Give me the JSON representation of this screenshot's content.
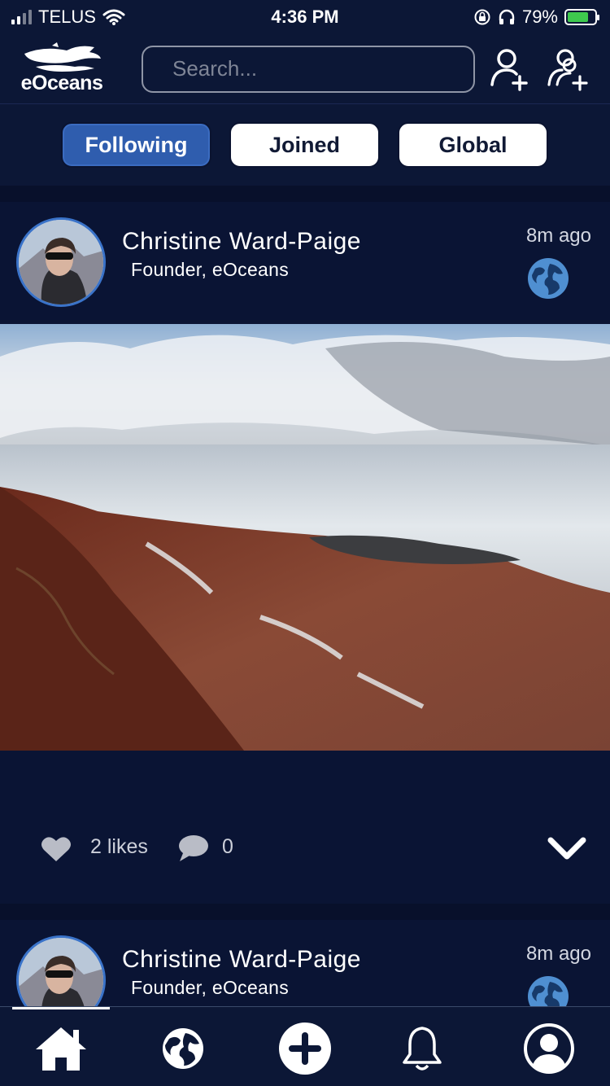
{
  "status_bar": {
    "carrier": "TELUS",
    "time": "4:36 PM",
    "battery": "79%",
    "battery_level": 0.79,
    "icons": [
      "signal-icon",
      "wifi-icon",
      "orientation-lock-icon",
      "headphones-icon",
      "battery-charging-icon"
    ]
  },
  "header": {
    "logo_text": "eOceans",
    "search_placeholder": "Search...",
    "icons": [
      "search-icon",
      "filter-icon",
      "add-person-icon",
      "add-group-icon"
    ]
  },
  "tabs": [
    {
      "label": "Following",
      "active": true
    },
    {
      "label": "Joined",
      "active": false
    },
    {
      "label": "Global",
      "active": false
    }
  ],
  "posts": [
    {
      "author": "Christine Ward-Paige",
      "role": "Founder, eOceans",
      "time": "8m ago",
      "visibility_icon": "globe-icon",
      "likes": "2 likes",
      "comments": "0"
    },
    {
      "author": "Christine Ward-Paige",
      "role": "Founder, eOceans",
      "time": "8m ago",
      "visibility_icon": "globe-icon"
    }
  ],
  "bottom_nav": [
    "home-icon",
    "explore-globe-icon",
    "add-post-icon",
    "notifications-icon",
    "profile-icon"
  ],
  "colors": {
    "background": "#0c1736",
    "active_tab": "#2f5dae",
    "accent_blue": "#3a73c9",
    "battery_green": "#3ec94e"
  }
}
